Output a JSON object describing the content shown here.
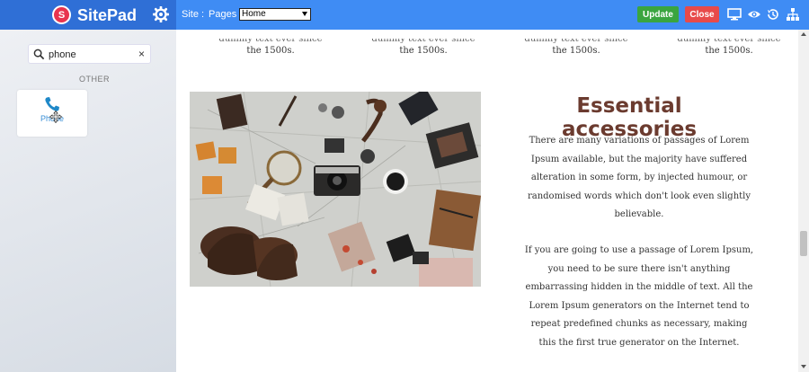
{
  "app": {
    "name": "SitePad"
  },
  "toolbar": {
    "site_label": "Site :",
    "pages_label": "Pages :",
    "pages_selected": "Home",
    "update_label": "Update",
    "close_label": "Close"
  },
  "sidebar": {
    "search": {
      "value": "phone",
      "clear": "×"
    },
    "section_label": "OTHER",
    "widget": {
      "label": "Phone"
    }
  },
  "canvas": {
    "features": [
      {
        "line1": "dummy text ever since",
        "line2": "the 1500s."
      },
      {
        "line1": "dummy text ever since",
        "line2": "the 1500s."
      },
      {
        "line1": "dummy text ever since",
        "line2": "the 1500s."
      },
      {
        "line1": "dummy text ever since",
        "line2": "the 1500s."
      }
    ],
    "heading": "Essential accessories",
    "paragraph1": "There are many variations of passages of Lorem Ipsum available, but the majority have suffered alteration in some form, by injected humour, or randomised words which don't look even slightly believable.",
    "paragraph2": "If you are going to use a passage of Lorem Ipsum, you need to be sure there isn't anything embarrassing hidden in the middle of text. All the Lorem Ipsum generators on the Internet tend to repeat predefined chunks as necessary, making this the first true generator on the Internet."
  },
  "colors": {
    "topbar": "#3f8cf4",
    "update": "#3aa53f",
    "close": "#e84a4a",
    "heading": "#6b3b2f"
  }
}
